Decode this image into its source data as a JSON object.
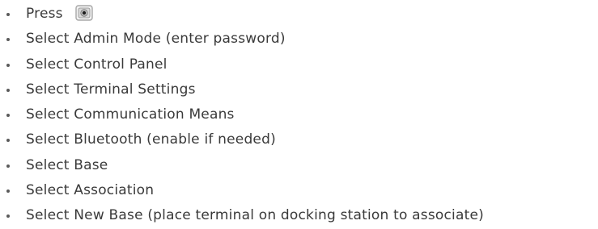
{
  "instructions": {
    "steps": [
      {
        "text": "Press",
        "icon": "home-key-icon"
      },
      {
        "text": "Select Admin Mode (enter password)"
      },
      {
        "text": "Select Control Panel"
      },
      {
        "text": "Select Terminal Settings"
      },
      {
        "text": "Select Communication Means"
      },
      {
        "text": "Select Bluetooth (enable if needed)"
      },
      {
        "text": "Select Base"
      },
      {
        "text": "Select Association"
      },
      {
        "text": "Select New Base (place terminal on docking station to associate)"
      }
    ]
  },
  "colors": {
    "text": "#3a3a3a",
    "bullet": "#5a5a5a",
    "icon_frame": "#a8a8a8"
  }
}
